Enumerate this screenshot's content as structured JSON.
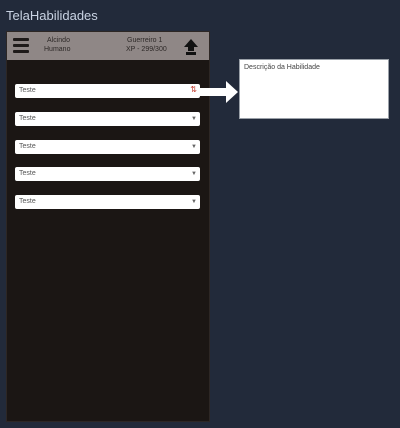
{
  "screen": {
    "title": "TelaHabilidades"
  },
  "header": {
    "menu_icon": "hamburger-menu-icon",
    "character_name": "Alcindo",
    "character_race": "Humano",
    "character_class": "Guerreiro 1",
    "character_xp": "XP - 299/300",
    "level_up_icon": "arrow-up-icon"
  },
  "skills": [
    {
      "value": "Teste",
      "state": "open"
    },
    {
      "value": "Teste",
      "state": "closed"
    },
    {
      "value": "Teste",
      "state": "closed"
    },
    {
      "value": "Teste",
      "state": "closed"
    },
    {
      "value": "Teste",
      "state": "closed"
    }
  ],
  "description": {
    "text": "Descrição da Habilidade"
  },
  "colors": {
    "background": "#222a3a",
    "panel": "#1b1614",
    "header": "#8f8786",
    "active_caret": "#c0392b"
  }
}
